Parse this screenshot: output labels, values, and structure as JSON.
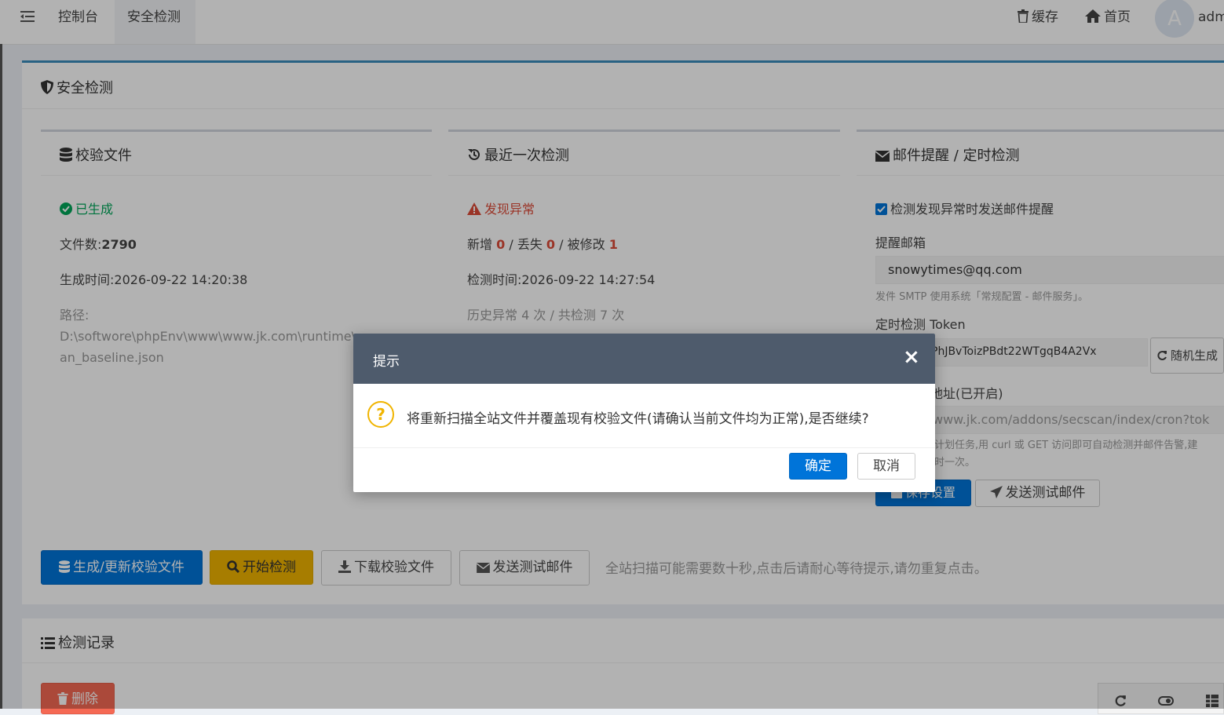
{
  "topbar": {
    "tabs": [
      {
        "label": "控制台"
      },
      {
        "label": "安全检测"
      }
    ],
    "cache_label": "缓存",
    "home_label": "首页",
    "avatar_letter": "A",
    "user_label": "adm"
  },
  "panel": {
    "title": "安全检测",
    "baseline": {
      "title": "校验文件",
      "status": "已生成",
      "file_count_label": "文件数:",
      "file_count": "2790",
      "gen_time_label": "生成时间:",
      "gen_time": "2026-09-22 14:20:38",
      "path_label": "路径:",
      "path_line1": "D:\\softwore\\phpEnv\\www\\www.jk.com\\runtime\\secsc",
      "path_line2": "an_baseline.json"
    },
    "last_scan": {
      "title": "最近一次检测",
      "status": "发现异常",
      "added_label": "新增",
      "added": "0",
      "lost_label": "丢失",
      "lost": "0",
      "modified_label": "被修改",
      "modified": "1",
      "scan_time_label": "检测时间:",
      "scan_time": "2026-09-22 14:27:54",
      "history": "历史异常 4 次 / 共检测 7 次"
    },
    "mail": {
      "title": "邮件提醒 / 定时检测",
      "checkbox_label": "检测发现异常时发送邮件提醒",
      "email_label": "提醒邮箱",
      "email_value": "snowytimes@qq.com",
      "smtp_hint": "发件 SMTP 使用系统「常规配置 - 邮件服务」。",
      "token_label": "定时检测 Token",
      "token_value": "PhJBvToizPBdt22WTgqB4A2Vx",
      "random_btn": "随机生成",
      "cron_label": "地址(已开启)",
      "cron_url": "www.jk.com/addons/secscan/index/cron?tok",
      "cron_hint1": "计划任务,用 curl 或 GET 访问即可自动检测并邮件告警,建",
      "cron_hint2": "时一次。",
      "save_btn": "保存设置",
      "test_mail_btn": "发送测试邮件"
    },
    "actions": {
      "generate": "生成/更新校验文件",
      "scan": "开始检测",
      "download": "下载校验文件",
      "test_mail": "发送测试邮件",
      "hint": "全站扫描可能需要数十秒,点击后请耐心等待提示,请勿重复点击。"
    }
  },
  "records": {
    "title": "检测记录",
    "delete_btn": "删除"
  },
  "modal": {
    "title": "提示",
    "message": "将重新扫描全站文件并覆盖现有校验文件(请确认当前文件均为正常),是否继续?",
    "ok": "确定",
    "cancel": "取消"
  },
  "colors": {
    "primary": "#0074d9",
    "warning": "#f0b400",
    "danger": "#dd4b39",
    "success": "#00a65a",
    "modal_header": "#4e5b6c"
  }
}
